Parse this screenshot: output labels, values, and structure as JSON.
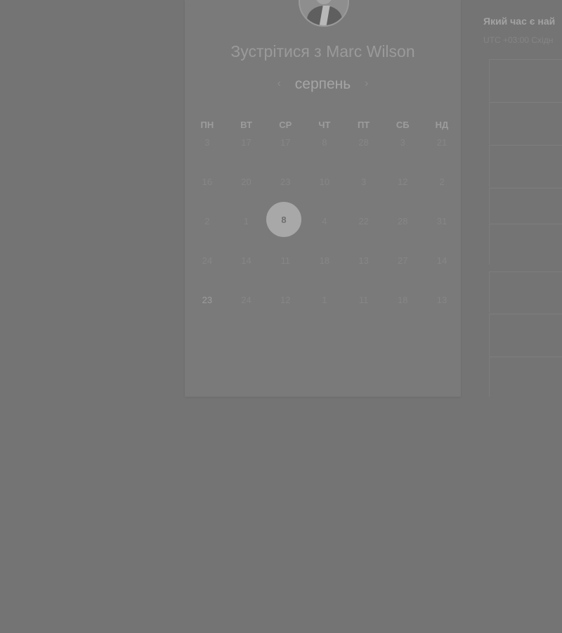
{
  "card": {
    "title": "Зустрітися з Marc Wilson",
    "month": "серпень",
    "prev_arrow": "‹",
    "next_arrow": "›"
  },
  "calendar": {
    "weekdays": [
      "ПН",
      "ВТ",
      "СР",
      "ЧТ",
      "ПТ",
      "СБ",
      "НД"
    ],
    "weeks": [
      [
        "3",
        "17",
        "17",
        "8",
        "28",
        "3",
        "21"
      ],
      [
        "16",
        "20",
        "23",
        "10",
        "3",
        "12",
        "2"
      ],
      [
        "2",
        "1",
        "8",
        "4",
        "22",
        "28",
        "31"
      ],
      [
        "24",
        "14",
        "11",
        "18",
        "13",
        "27",
        "14"
      ],
      [
        "23",
        "24",
        "12",
        "1",
        "11",
        "18",
        "13"
      ]
    ],
    "selected_day": "8",
    "highlighted_day": "23"
  },
  "right_panel": {
    "title": "Який час є най",
    "timezone": "UTC +03:00 Східн"
  }
}
